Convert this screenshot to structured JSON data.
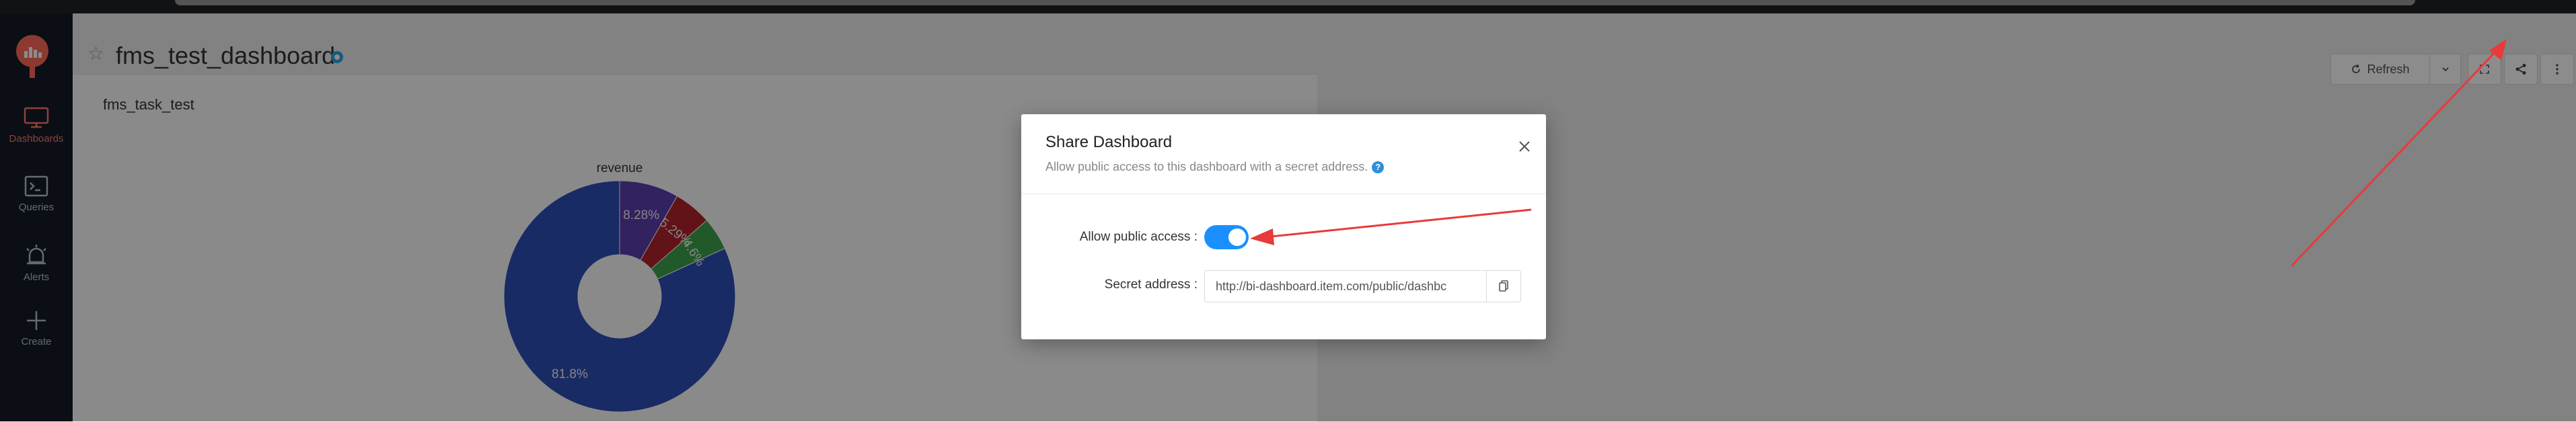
{
  "sidebar": {
    "items": [
      {
        "label": "Dashboards",
        "icon": "monitor-icon",
        "active": true
      },
      {
        "label": "Queries",
        "icon": "terminal-icon",
        "active": false
      },
      {
        "label": "Alerts",
        "icon": "bell-icon",
        "active": false
      },
      {
        "label": "Create",
        "icon": "plus-icon",
        "active": false
      }
    ]
  },
  "header": {
    "title": "fms_test_dashboard",
    "refresh_label": "Refresh"
  },
  "widget": {
    "title": "fms_task_test"
  },
  "chart_data": {
    "type": "pie",
    "title": "revenue",
    "slices": [
      {
        "label": "81.8%",
        "value": 81.8,
        "color": "#2f4fb8"
      },
      {
        "label": "4.6%",
        "value": 4.6,
        "color": "#3fa34d"
      },
      {
        "label": "5.29%",
        "value": 5.29,
        "color": "#b3232b"
      },
      {
        "label": "8.28%",
        "value": 8.28,
        "color": "#5b3eb0"
      }
    ]
  },
  "modal": {
    "title": "Share Dashboard",
    "description": "Allow public access to this dashboard with a secret address.",
    "help_icon": "?",
    "public_access_label": "Allow public access",
    "public_access_enabled": true,
    "secret_address_label": "Secret address",
    "secret_address_value": "http://bi-dashboard.item.com/public/dashbc"
  },
  "colors": {
    "accent": "#ff6b5a",
    "toggle_on": "#1a90ff",
    "arrow": "#e83a3a",
    "sidebar_bg": "#151b27"
  }
}
